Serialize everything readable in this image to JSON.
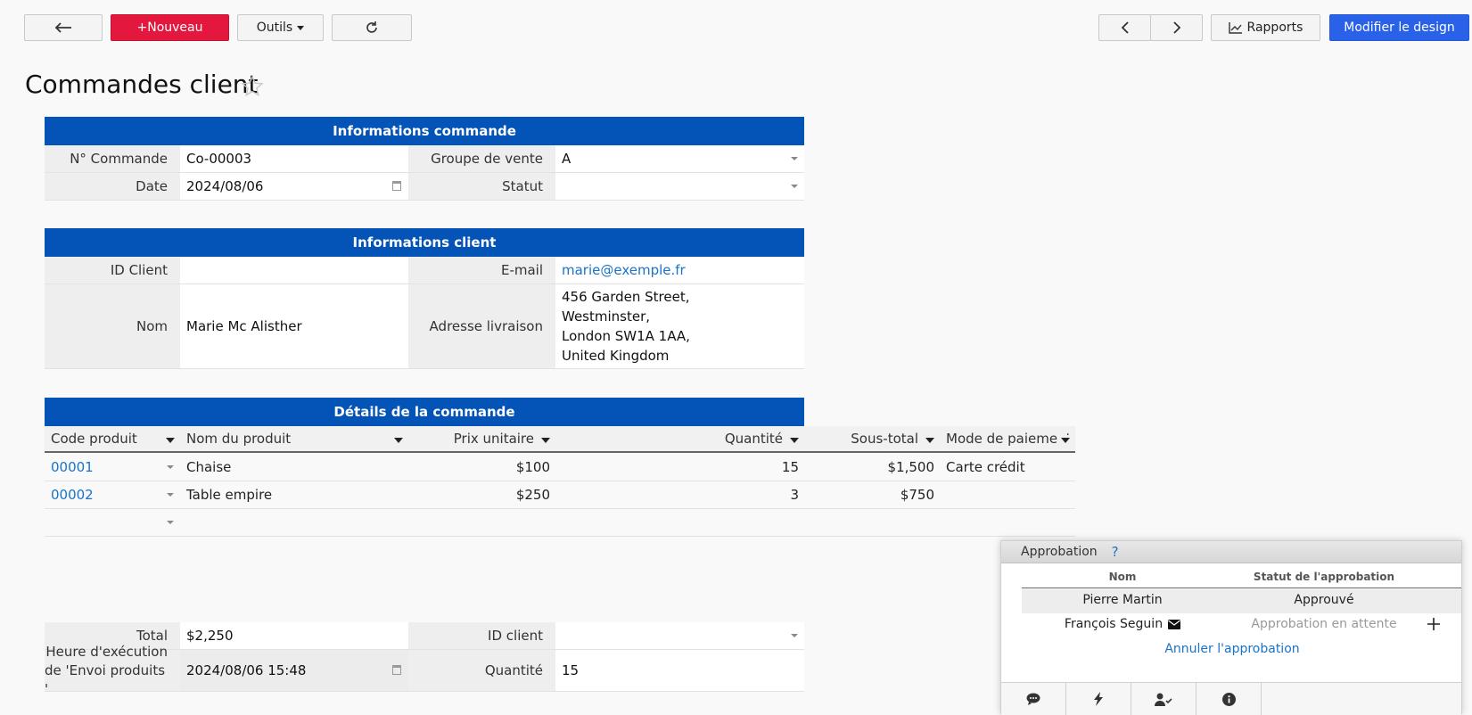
{
  "toolbar": {
    "new_label": "+Nouveau",
    "tools_label": "Outils",
    "reports_label": "Rapports",
    "design_label": "Modifier le design"
  },
  "page": {
    "title": "Commandes client"
  },
  "order_info": {
    "header": "Informations commande",
    "order_no_label": "N° Commande",
    "order_no": "Co-00003",
    "sales_group_label": "Groupe de vente",
    "sales_group": "A",
    "date_label": "Date",
    "date": "2024/08/06",
    "status_label": "Statut",
    "status": ""
  },
  "client_info": {
    "header": "Informations client",
    "client_id_label": "ID Client",
    "client_id": "",
    "email_label": "E-mail",
    "email": "marie@exemple.fr",
    "name_label": "Nom",
    "name": "Marie Mc Alisther",
    "address_label": "Adresse livraison",
    "address_lines": [
      "456 Garden Street,",
      "Westminster,",
      "London SW1A 1AA,",
      "United Kingdom"
    ]
  },
  "order_details": {
    "header": "Détails de la commande",
    "columns": [
      "Code produit",
      "Nom du produit",
      "Prix unitaire",
      "Quantité",
      "Sous-total",
      "Mode de paiement"
    ],
    "rows": [
      {
        "code": "00001",
        "name": "Chaise",
        "unit_price": "$100",
        "qty": "15",
        "subtotal": "$1,500",
        "payment": "Carte crédit"
      },
      {
        "code": "00002",
        "name": "Table empire",
        "unit_price": "$250",
        "qty": "3",
        "subtotal": "$750",
        "payment": ""
      }
    ]
  },
  "summary": {
    "total_label": "Total",
    "total": "$2,250",
    "client_id_label": "ID client",
    "client_id": "",
    "exec_time_label_1": "Heure d'exécution",
    "exec_time_label_2": "de 'Envoi produits '",
    "exec_time": "2024/08/06 15:48",
    "qty_label": "Quantité",
    "qty": "15"
  },
  "approval": {
    "title": "Approbation",
    "help": "?",
    "col_name": "Nom",
    "col_status": "Statut de l'approbation",
    "rows": [
      {
        "name": "Pierre Martin",
        "status": "Approuvé"
      },
      {
        "name": "François Seguin",
        "status": "Approbation en attente"
      }
    ],
    "cancel_label": "Annuler l'approbation"
  }
}
